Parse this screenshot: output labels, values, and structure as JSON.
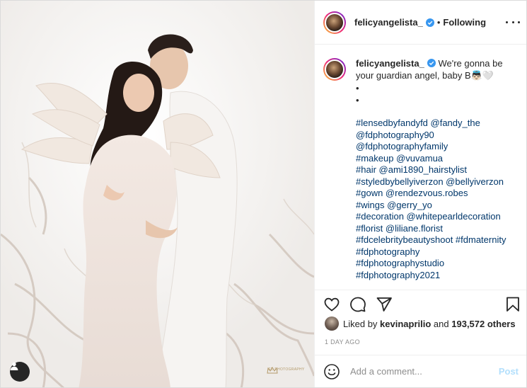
{
  "post": {
    "username": "felicyangelista_",
    "follow_separator": "•",
    "follow_status": "Following",
    "watermark_text": "FD PHOTOGRAPHY"
  },
  "caption": {
    "username": "felicyangelista_",
    "text": "We're gonna be your guardian angel, baby B👼🏻🤍",
    "dots": [
      "•",
      "•"
    ],
    "lines": [
      "#lensedbyfandyfd @fandy_the",
      "@fdphotography90",
      "@fdphotographyfamily",
      "#makeup @vuvamua",
      "#hair @ami1890_hairstylist",
      "#styledbybellyiverzon @bellyiverzon",
      "#gown @rendezvous.robes",
      "#wings @gerry_yo",
      "#decoration @whitepearldecoration",
      "#florist @liliane.florist",
      "#fdcelebritybeautyshoot #fdmaternity",
      "#fdphotography",
      "#fdphotographystudio",
      "#fdphotography2021"
    ]
  },
  "likes": {
    "prefix": "Liked by",
    "user": "kevinaprilio",
    "connector": "and",
    "others": "193,572 others"
  },
  "timestamp": "1 DAY AGO",
  "comment_box": {
    "placeholder": "Add a comment...",
    "post_label": "Post"
  },
  "icons": {
    "verified": "verified-badge-icon",
    "more": "more-options-icon",
    "like": "heart-icon",
    "comment": "comment-icon",
    "share": "share-icon",
    "save": "bookmark-icon",
    "emoji": "emoji-icon",
    "tag": "user-tag-icon"
  },
  "colors": {
    "link": "#00376b",
    "verified": "#3897f0",
    "post_disabled": "#b2dffc",
    "muted": "#8e8e8e"
  }
}
